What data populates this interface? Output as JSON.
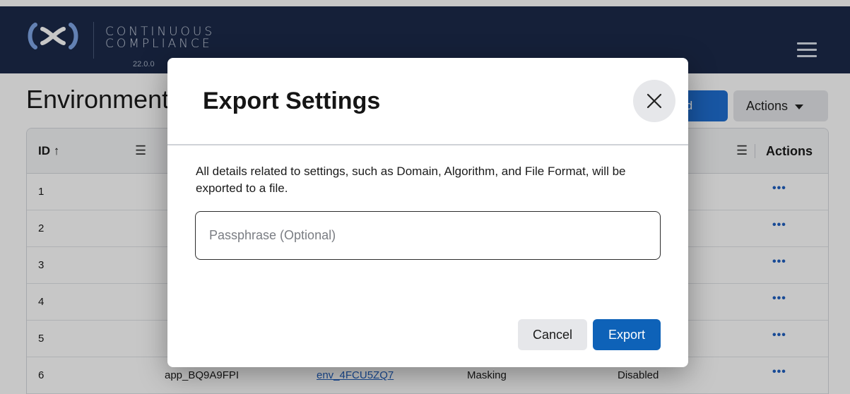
{
  "header": {
    "brand_line1": "CONTINUOUS",
    "brand_line2": "COMPLIANCE",
    "version": "22.0.0",
    "logo_icon": "cc-logo-icon",
    "menu_icon": "hamburger-menu-icon"
  },
  "page": {
    "title": "Environments",
    "add_button_label": "Add Environment",
    "actions_button_label": "Actions"
  },
  "table": {
    "columns": [
      "ID ↑",
      "Actions"
    ],
    "rows": [
      {
        "id": "1",
        "app": "",
        "env": "",
        "type": "",
        "status": ""
      },
      {
        "id": "2",
        "app": "",
        "env": "",
        "type": "",
        "status": ""
      },
      {
        "id": "3",
        "app": "",
        "env": "",
        "type": "",
        "status": ""
      },
      {
        "id": "4",
        "app": "",
        "env": "",
        "type": "",
        "status": ""
      },
      {
        "id": "5",
        "app": "",
        "env": "",
        "type": "",
        "status": ""
      },
      {
        "id": "6",
        "app": "app_BQ9A9FPI",
        "env": "env_4FCU5ZQ7",
        "type": "Masking",
        "status": "Disabled"
      }
    ],
    "row_actions": "•••"
  },
  "modal": {
    "title": "Export Settings",
    "description": "All details related to settings, such as Domain, Algorithm, and File Format, will be exported to a file.",
    "passphrase_placeholder": "Passphrase (Optional)",
    "passphrase_value": "",
    "cancel_label": "Cancel",
    "export_label": "Export"
  },
  "colors": {
    "header_bg": "#1b2a4a",
    "primary": "#0e62b8",
    "link": "#1f5fbf"
  }
}
